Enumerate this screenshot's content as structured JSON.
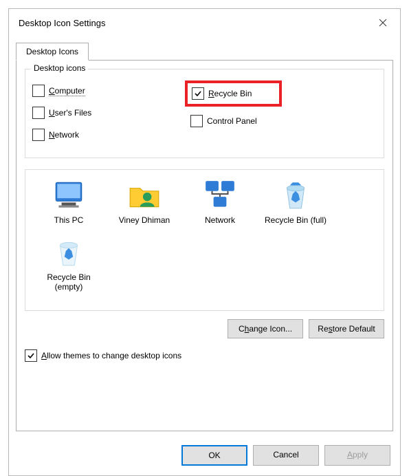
{
  "title": "Desktop Icon Settings",
  "tab": {
    "label": "Desktop Icons"
  },
  "group": {
    "legend": "Desktop icons"
  },
  "checks": {
    "computer": {
      "label": "Computer",
      "checked": false,
      "accel": "C"
    },
    "users_files": {
      "label": "User's Files",
      "checked": false,
      "accel": "U"
    },
    "network": {
      "label": "Network",
      "checked": false,
      "accel": "N"
    },
    "recycle_bin": {
      "label": "Recycle Bin",
      "checked": true,
      "accel": "R"
    },
    "control_panel": {
      "label": "Control Panel",
      "checked": false,
      "accel": ""
    }
  },
  "icons": {
    "this_pc": {
      "label": "This PC"
    },
    "user": {
      "label": "Viney Dhiman"
    },
    "network": {
      "label": "Network"
    },
    "rb_full": {
      "label": "Recycle Bin (full)"
    },
    "rb_empty": {
      "label": "Recycle Bin (empty)"
    }
  },
  "buttons": {
    "change_icon": "Change Icon...",
    "restore_default": "Restore Default",
    "ok": "OK",
    "cancel": "Cancel",
    "apply": "Apply"
  },
  "allow_themes": {
    "label": "Allow themes to change desktop icons",
    "checked": true,
    "accel": "A"
  }
}
